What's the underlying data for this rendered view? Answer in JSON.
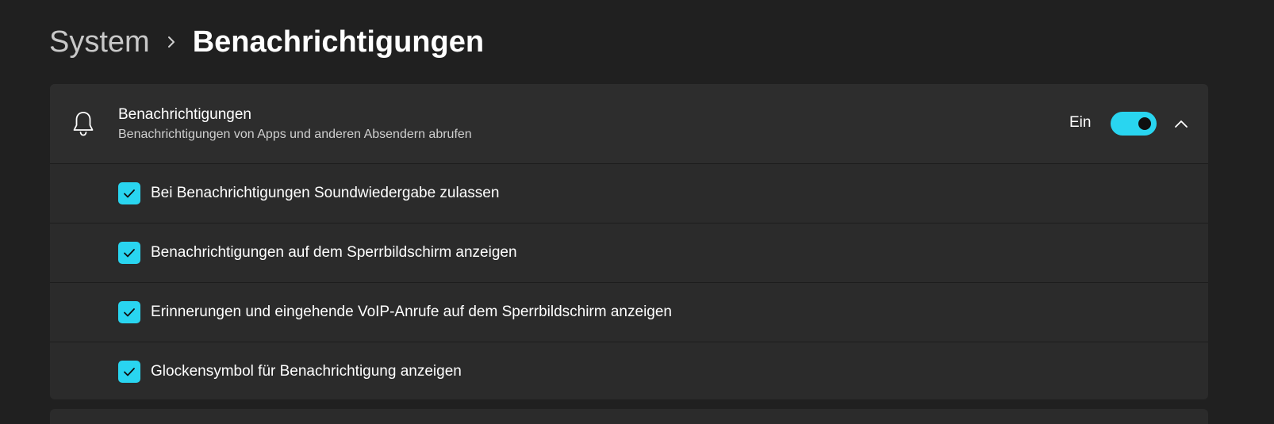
{
  "breadcrumb": {
    "parent": "System",
    "current": "Benachrichtigungen"
  },
  "notifications": {
    "title": "Benachrichtigungen",
    "subtitle": "Benachrichtigungen von Apps und anderen Absendern abrufen",
    "toggle_state_label": "Ein",
    "toggle_on": true,
    "expanded": true,
    "icon": "bell-icon",
    "options": [
      {
        "label": "Bei Benachrichtigungen Soundwiedergabe zulassen",
        "checked": true
      },
      {
        "label": "Benachrichtigungen auf dem Sperrbildschirm anzeigen",
        "checked": true
      },
      {
        "label": "Erinnerungen und eingehende VoIP-Anrufe auf dem Sperrbildschirm anzeigen",
        "checked": true
      },
      {
        "label": "Glockensymbol für Benachrichtigung anzeigen",
        "checked": true
      }
    ]
  },
  "colors": {
    "accent": "#29d5f0",
    "background": "#202020",
    "card": "#2b2b2b"
  }
}
